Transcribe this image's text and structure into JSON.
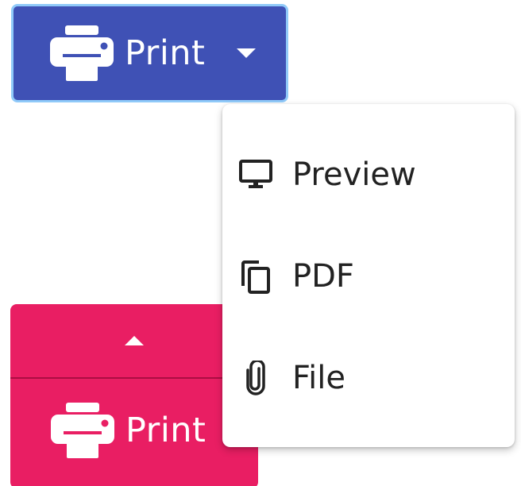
{
  "colors": {
    "top_button": "#3f51b5",
    "top_focus_ring": "#90caf9",
    "bottom_button": "#e91e63",
    "menu_bg": "#ffffff",
    "menu_text": "#222222"
  },
  "top_split_button": {
    "label": "Print",
    "icon": "printer-icon",
    "caret_icon": "caret-down-icon"
  },
  "bottom_split_button": {
    "label": "Print",
    "icon": "printer-icon",
    "caret_icon": "caret-up-icon"
  },
  "menu": {
    "items": [
      {
        "label": "Preview",
        "icon": "monitor-icon"
      },
      {
        "label": "PDF",
        "icon": "copy-icon"
      },
      {
        "label": "File",
        "icon": "paperclip-icon"
      }
    ]
  }
}
